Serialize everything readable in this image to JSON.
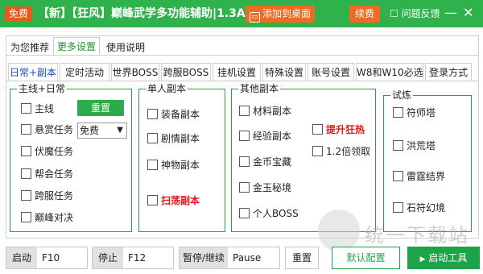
{
  "titlebar": {
    "free_badge": "免费",
    "title": "【新】【狂风】巅峰武学多功能辅助|1.3A",
    "add_desktop": "添加到桌面",
    "renew": "续费",
    "feedback": "问题反馈",
    "minimize_glyph": "—",
    "close_glyph": "✕",
    "colors": {
      "bar": "#2fb14b",
      "accent": "#ef6a22"
    }
  },
  "tabs": [
    "为您推荐",
    "更多设置",
    "使用说明"
  ],
  "subtabs": [
    "日常+副本",
    "定时活动",
    "世界BOSS",
    "跨服BOSS",
    "挂机设置",
    "特殊设置",
    "账号设置",
    "W8和W10必选",
    "登录方式"
  ],
  "daily": {
    "title": "主线+日常",
    "items": [
      "主线",
      "悬赏任务",
      "伏魔任务",
      "帮会任务",
      "跨服任务",
      "巅峰对决"
    ],
    "reset_button": "重置",
    "select_value": "免费"
  },
  "single": {
    "title": "单人副本",
    "items": [
      "装备副本",
      "剧情副本",
      "神物副本"
    ],
    "sweep": "扫荡副本"
  },
  "other": {
    "title": "其他副本",
    "items": [
      "材料副本",
      "经验副本",
      "金币宝藏",
      "金玉秘境",
      "个人BOSS"
    ],
    "boost": "提升狂热",
    "double": "1.2倍领取"
  },
  "trial": {
    "title": "试炼",
    "items": [
      "符师塔",
      "洪荒塔",
      "雷霆结界",
      "石符幻境"
    ]
  },
  "bottom": {
    "start_label": "启动",
    "start_key": "F10",
    "stop_label": "停止",
    "stop_key": "F12",
    "pause_label": "暂停/继续",
    "pause_key": "Pause",
    "reset": "重置",
    "default_config": "默认配置",
    "launch": "启动工具"
  },
  "watermark": "统一下载站"
}
